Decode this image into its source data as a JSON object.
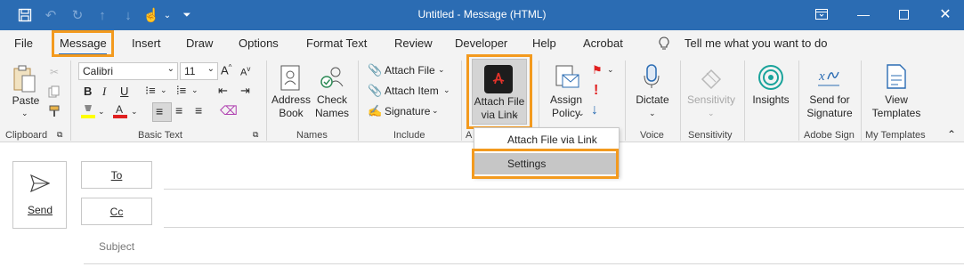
{
  "titlebar": {
    "title": "Untitled  -  Message (HTML)",
    "icons": [
      "save-icon",
      "undo-icon",
      "redo-icon",
      "up-icon",
      "down-icon",
      "touch-icon",
      "customize-icon"
    ],
    "controls": [
      "ribbon-display-icon",
      "minimize-icon",
      "maximize-icon",
      "close-icon"
    ]
  },
  "tabs": [
    "File",
    "Message",
    "Insert",
    "Draw",
    "Options",
    "Format Text",
    "Review",
    "Developer",
    "Help",
    "Acrobat"
  ],
  "tell_me": "Tell me what you want to do",
  "ribbon": {
    "clipboard": {
      "paste": "Paste",
      "label": "Clipboard"
    },
    "basic_text": {
      "font": "Calibri",
      "size": "11",
      "label": "Basic Text"
    },
    "names": {
      "address_book": [
        "Address",
        "Book"
      ],
      "check_names": [
        "Check",
        "Names"
      ],
      "label": "Names"
    },
    "include": {
      "attach_file": "Attach File",
      "attach_item": "Attach Item",
      "signature": "Signature",
      "label": "Include"
    },
    "acrobat": {
      "attach_via_link": [
        "Attach File",
        "via Link"
      ],
      "label": "A"
    },
    "tags": {
      "assign_policy": [
        "Assign",
        "Policy"
      ]
    },
    "voice": {
      "dictate": "Dictate",
      "label": "Voice"
    },
    "sensitivity": {
      "button": "Sensitivity",
      "label": "Sensitivity"
    },
    "insights": {
      "button": "Insights"
    },
    "adobe_sign": {
      "button": [
        "Send for",
        "Signature"
      ],
      "label": "Adobe Sign"
    },
    "my_templates": {
      "button": [
        "View",
        "Templates"
      ],
      "label": "My Templates"
    }
  },
  "dropdown": {
    "items": [
      "Attach File via Link",
      "Settings"
    ]
  },
  "compose": {
    "send": "Send",
    "to": "To",
    "cc": "Cc",
    "subject": "Subject"
  },
  "colors": {
    "titlebar": "#2b6cb3",
    "highlight": "#f39a1e",
    "adobe_red": "#e3322a"
  }
}
